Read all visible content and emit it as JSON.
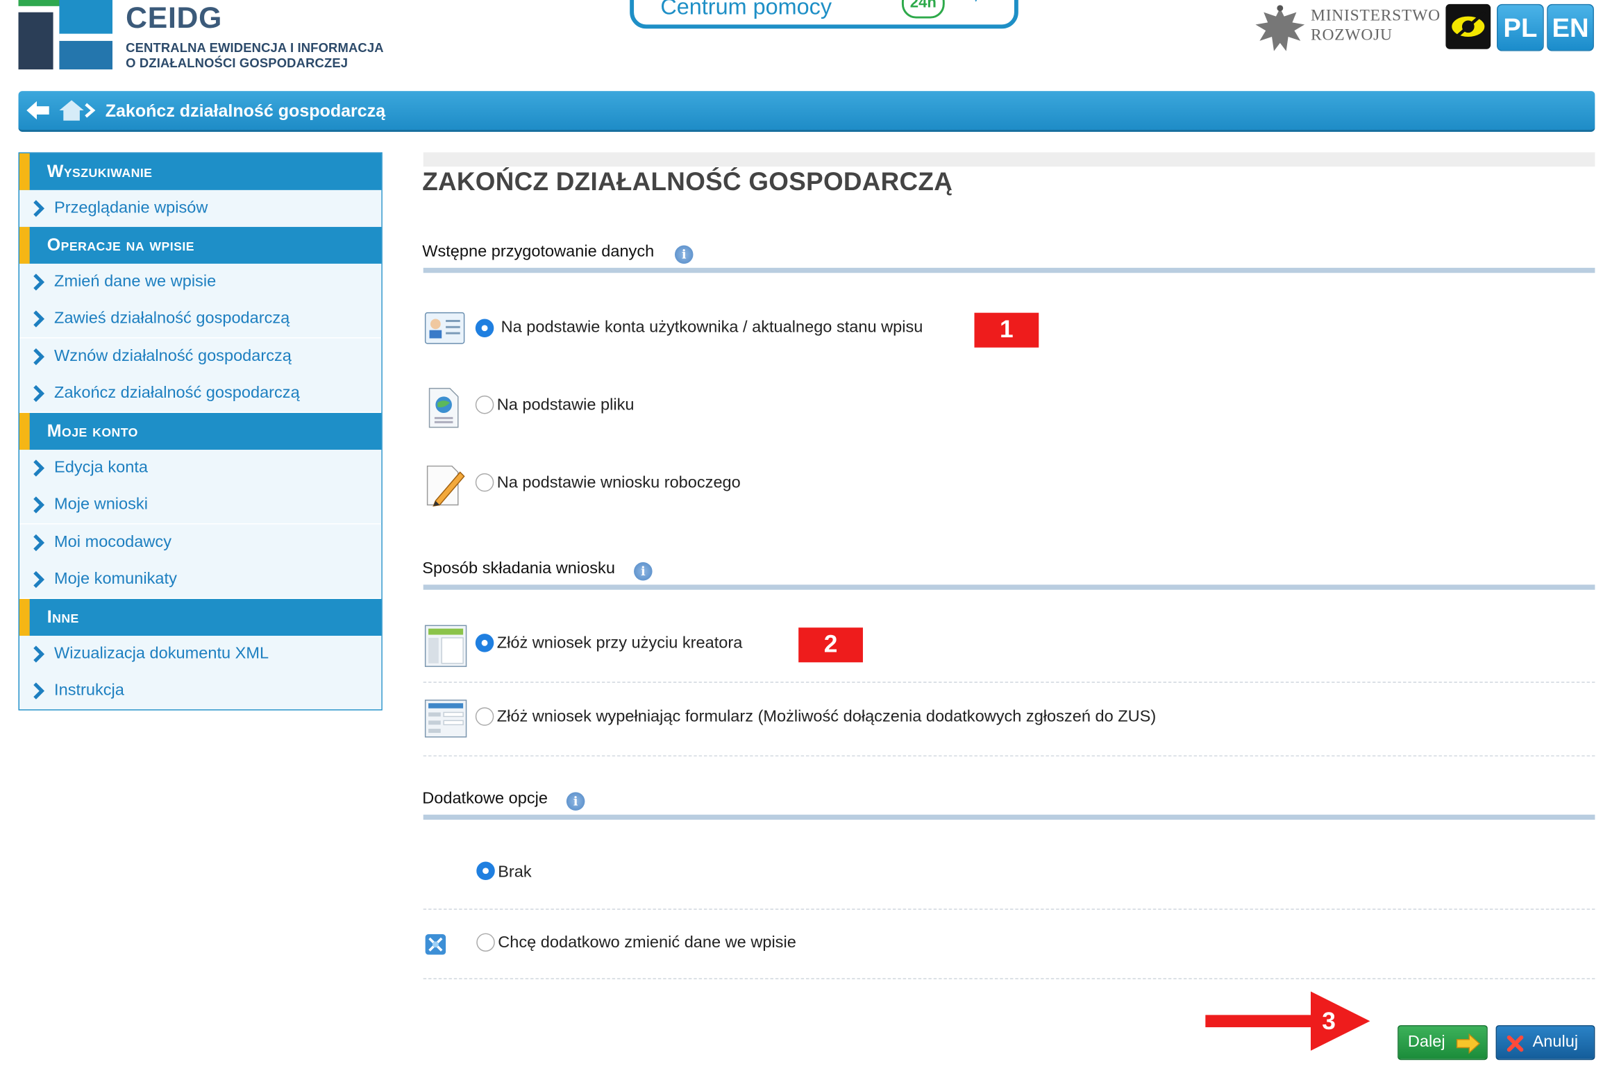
{
  "header": {
    "brand_title": "CEIDG",
    "brand_sub_line1": "CENTRALNA EWIDENCJA I INFORMACJA",
    "brand_sub_line2": "O DZIAŁALNOŚCI GOSPODARCZEJ",
    "help_center_label": "Centrum pomocy",
    "help_badge": "24h",
    "ministry_line1": "MINISTERSTWO",
    "ministry_line2": "ROZWOJU",
    "lang_pl": "PL",
    "lang_en": "EN"
  },
  "breadcrumb": {
    "current": "Zakończ działalność gospodarczą"
  },
  "sidebar": {
    "sections": [
      {
        "title": "Wyszukiwanie",
        "items": [
          "Przeglądanie wpisów"
        ]
      },
      {
        "title": "Operacje na wpisie",
        "items": [
          "Zmień dane we wpisie",
          "Zawieś działalność gospodarczą",
          "Wznów działalność gospodarczą",
          "Zakończ działalność gospodarczą"
        ]
      },
      {
        "title": "Moje konto",
        "items": [
          "Edycja konta",
          "Moje wnioski",
          "Moi mocodawcy",
          "Moje komunikaty"
        ]
      },
      {
        "title": "Inne",
        "items": [
          "Wizualizacja dokumentu XML",
          "Instrukcja"
        ]
      }
    ]
  },
  "main": {
    "page_title": "ZAKOŃCZ DZIAŁALNOŚĆ GOSPODARCZĄ",
    "section1": {
      "title": "Wstępne przygotowanie danych",
      "options": [
        {
          "label": "Na podstawie konta użytkownika / aktualnego stanu wpisu",
          "selected": true
        },
        {
          "label": "Na podstawie pliku",
          "selected": false
        },
        {
          "label": "Na podstawie wniosku roboczego",
          "selected": false
        }
      ],
      "marker": "1"
    },
    "section2": {
      "title": "Sposób składania wniosku",
      "options": [
        {
          "label": "Złóż wniosek przy użyciu kreatora",
          "selected": true
        },
        {
          "label": "Złóż wniosek wypełniając formularz (Możliwość dołączenia dodatkowych zgłoszeń do ZUS)",
          "selected": false
        }
      ],
      "marker": "2"
    },
    "section3": {
      "title": "Dodatkowe opcje",
      "options": [
        {
          "label": "Brak",
          "selected": true
        },
        {
          "label": "Chcę dodatkowo zmienić dane we wpisie",
          "selected": false
        }
      ]
    },
    "marker3": "3",
    "buttons": {
      "next_label": "Dalej",
      "cancel_label": "Anuluj"
    }
  },
  "colors": {
    "primary_blue": "#1e8fc8",
    "accent_yellow": "#f5b615",
    "marker_red": "#ee1c1c",
    "next_green": "#2ca14b"
  }
}
